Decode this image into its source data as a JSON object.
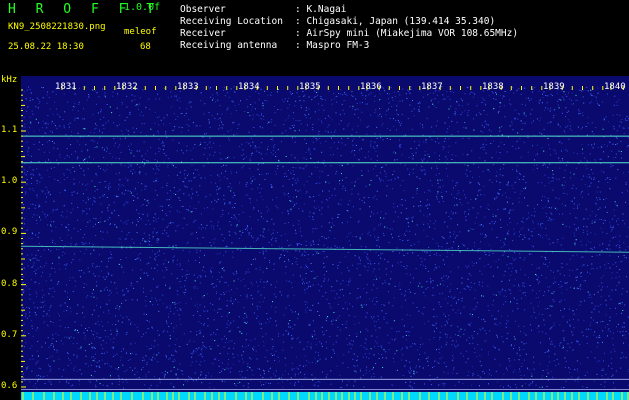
{
  "header": {
    "title": "H R O F F T",
    "version": "1.0.0f",
    "filename": "KN9_2508221830.png",
    "mode_label": "meleof",
    "mode_value": "68",
    "timestamp": "25.08.22 18:30"
  },
  "info": [
    {
      "label": "Observer",
      "value": ": K.Nagai"
    },
    {
      "label": "Receiving Location",
      "value": ": Chigasaki, Japan (139.414 35.340)"
    },
    {
      "label": "Receiver",
      "value": ": AirSpy mini (Miakejima VOR 108.65MHz)"
    },
    {
      "label": "Receiving antenna",
      "value": ": Maspro FM-3"
    }
  ],
  "chart_data": {
    "type": "heatmap",
    "ylabel": "kHz",
    "y_ticks": [
      "1.1",
      "1.0",
      "0.9",
      "0.8",
      "0.7",
      "0.6"
    ],
    "y_range": [
      0.575,
      1.19
    ],
    "x_ticks": [
      "1831",
      "1832",
      "1833",
      "1834",
      "1835",
      "1836",
      "1837",
      "1838",
      "1839",
      "1840"
    ],
    "horizontal_lines_khz": [
      1.09,
      1.038,
      0.875,
      0.615,
      0.595
    ],
    "colors": {
      "background": "#0a0a6e",
      "noise": "#3a5cff",
      "signal": "#5cffd8",
      "axis": "#ffff00",
      "bottom_bar": "#00d8ff"
    }
  }
}
